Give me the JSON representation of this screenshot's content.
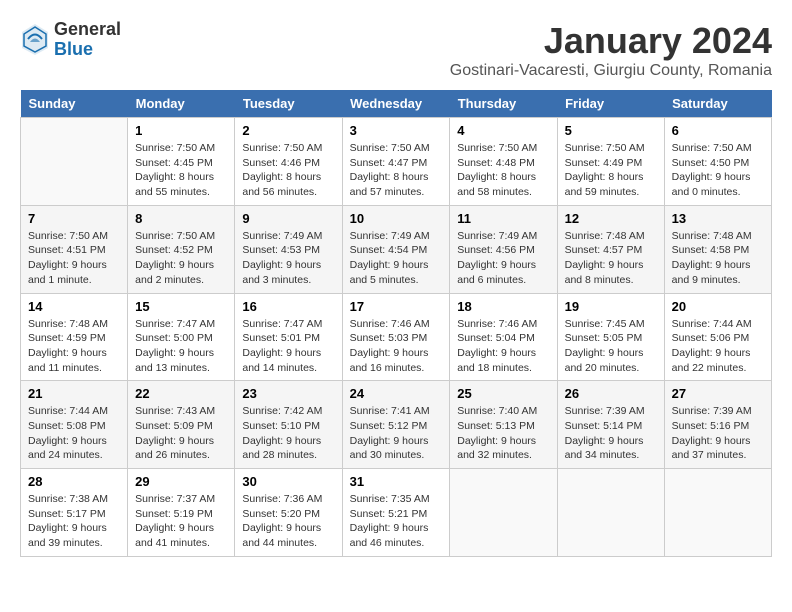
{
  "logo": {
    "general": "General",
    "blue": "Blue"
  },
  "header": {
    "title": "January 2024",
    "subtitle": "Gostinari-Vacaresti, Giurgiu County, Romania"
  },
  "columns": [
    "Sunday",
    "Monday",
    "Tuesday",
    "Wednesday",
    "Thursday",
    "Friday",
    "Saturday"
  ],
  "weeks": [
    [
      {
        "day": "",
        "info": ""
      },
      {
        "day": "1",
        "info": "Sunrise: 7:50 AM\nSunset: 4:45 PM\nDaylight: 8 hours\nand 55 minutes."
      },
      {
        "day": "2",
        "info": "Sunrise: 7:50 AM\nSunset: 4:46 PM\nDaylight: 8 hours\nand 56 minutes."
      },
      {
        "day": "3",
        "info": "Sunrise: 7:50 AM\nSunset: 4:47 PM\nDaylight: 8 hours\nand 57 minutes."
      },
      {
        "day": "4",
        "info": "Sunrise: 7:50 AM\nSunset: 4:48 PM\nDaylight: 8 hours\nand 58 minutes."
      },
      {
        "day": "5",
        "info": "Sunrise: 7:50 AM\nSunset: 4:49 PM\nDaylight: 8 hours\nand 59 minutes."
      },
      {
        "day": "6",
        "info": "Sunrise: 7:50 AM\nSunset: 4:50 PM\nDaylight: 9 hours\nand 0 minutes."
      }
    ],
    [
      {
        "day": "7",
        "info": "Sunrise: 7:50 AM\nSunset: 4:51 PM\nDaylight: 9 hours\nand 1 minute."
      },
      {
        "day": "8",
        "info": "Sunrise: 7:50 AM\nSunset: 4:52 PM\nDaylight: 9 hours\nand 2 minutes."
      },
      {
        "day": "9",
        "info": "Sunrise: 7:49 AM\nSunset: 4:53 PM\nDaylight: 9 hours\nand 3 minutes."
      },
      {
        "day": "10",
        "info": "Sunrise: 7:49 AM\nSunset: 4:54 PM\nDaylight: 9 hours\nand 5 minutes."
      },
      {
        "day": "11",
        "info": "Sunrise: 7:49 AM\nSunset: 4:56 PM\nDaylight: 9 hours\nand 6 minutes."
      },
      {
        "day": "12",
        "info": "Sunrise: 7:48 AM\nSunset: 4:57 PM\nDaylight: 9 hours\nand 8 minutes."
      },
      {
        "day": "13",
        "info": "Sunrise: 7:48 AM\nSunset: 4:58 PM\nDaylight: 9 hours\nand 9 minutes."
      }
    ],
    [
      {
        "day": "14",
        "info": "Sunrise: 7:48 AM\nSunset: 4:59 PM\nDaylight: 9 hours\nand 11 minutes."
      },
      {
        "day": "15",
        "info": "Sunrise: 7:47 AM\nSunset: 5:00 PM\nDaylight: 9 hours\nand 13 minutes."
      },
      {
        "day": "16",
        "info": "Sunrise: 7:47 AM\nSunset: 5:01 PM\nDaylight: 9 hours\nand 14 minutes."
      },
      {
        "day": "17",
        "info": "Sunrise: 7:46 AM\nSunset: 5:03 PM\nDaylight: 9 hours\nand 16 minutes."
      },
      {
        "day": "18",
        "info": "Sunrise: 7:46 AM\nSunset: 5:04 PM\nDaylight: 9 hours\nand 18 minutes."
      },
      {
        "day": "19",
        "info": "Sunrise: 7:45 AM\nSunset: 5:05 PM\nDaylight: 9 hours\nand 20 minutes."
      },
      {
        "day": "20",
        "info": "Sunrise: 7:44 AM\nSunset: 5:06 PM\nDaylight: 9 hours\nand 22 minutes."
      }
    ],
    [
      {
        "day": "21",
        "info": "Sunrise: 7:44 AM\nSunset: 5:08 PM\nDaylight: 9 hours\nand 24 minutes."
      },
      {
        "day": "22",
        "info": "Sunrise: 7:43 AM\nSunset: 5:09 PM\nDaylight: 9 hours\nand 26 minutes."
      },
      {
        "day": "23",
        "info": "Sunrise: 7:42 AM\nSunset: 5:10 PM\nDaylight: 9 hours\nand 28 minutes."
      },
      {
        "day": "24",
        "info": "Sunrise: 7:41 AM\nSunset: 5:12 PM\nDaylight: 9 hours\nand 30 minutes."
      },
      {
        "day": "25",
        "info": "Sunrise: 7:40 AM\nSunset: 5:13 PM\nDaylight: 9 hours\nand 32 minutes."
      },
      {
        "day": "26",
        "info": "Sunrise: 7:39 AM\nSunset: 5:14 PM\nDaylight: 9 hours\nand 34 minutes."
      },
      {
        "day": "27",
        "info": "Sunrise: 7:39 AM\nSunset: 5:16 PM\nDaylight: 9 hours\nand 37 minutes."
      }
    ],
    [
      {
        "day": "28",
        "info": "Sunrise: 7:38 AM\nSunset: 5:17 PM\nDaylight: 9 hours\nand 39 minutes."
      },
      {
        "day": "29",
        "info": "Sunrise: 7:37 AM\nSunset: 5:19 PM\nDaylight: 9 hours\nand 41 minutes."
      },
      {
        "day": "30",
        "info": "Sunrise: 7:36 AM\nSunset: 5:20 PM\nDaylight: 9 hours\nand 44 minutes."
      },
      {
        "day": "31",
        "info": "Sunrise: 7:35 AM\nSunset: 5:21 PM\nDaylight: 9 hours\nand 46 minutes."
      },
      {
        "day": "",
        "info": ""
      },
      {
        "day": "",
        "info": ""
      },
      {
        "day": "",
        "info": ""
      }
    ]
  ]
}
